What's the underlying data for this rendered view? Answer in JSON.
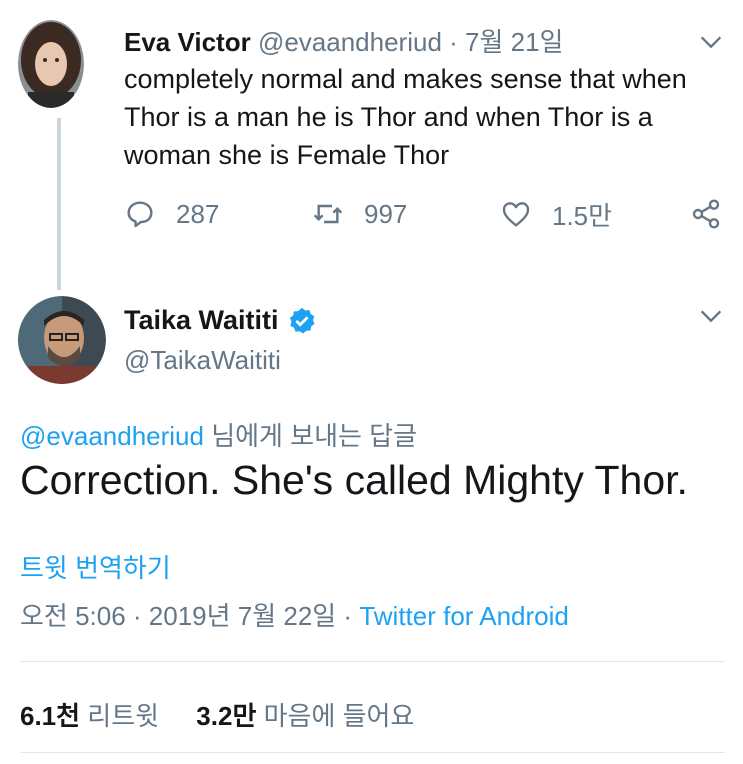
{
  "parent_tweet": {
    "author_name": "Eva Victor",
    "author_handle": "@evaandheriud",
    "separator": " · ",
    "date": "7월 21일",
    "text": "completely normal and makes sense that when Thor is a man he is Thor and when Thor is a woman she is Female Thor",
    "reply_count": "287",
    "retweet_count": "997",
    "like_count": "1.5만"
  },
  "main_tweet": {
    "author_name": "Taika Waititi",
    "author_handle": "@TaikaWaititi",
    "reply_to_handle": "@evaandheriud",
    "reply_to_suffix": " 님에게 보내는 답글",
    "text": "Correction. She's called Mighty Thor.",
    "translate_label": "트윗 번역하기",
    "timestamp": "오전 5:06 · 2019년 7월 22일 · ",
    "source": "Twitter for Android",
    "retweet_count": "6.1천",
    "retweet_label": " 리트윗",
    "like_count": "3.2만",
    "like_label": " 마음에 들어요"
  },
  "colors": {
    "accent": "#1da1f2",
    "muted": "#657786",
    "text": "#14171a",
    "divider": "#e1e8ed"
  },
  "icons": [
    "chevron-down-icon",
    "reply-icon",
    "retweet-icon",
    "like-icon",
    "share-icon",
    "verified-badge-icon"
  ]
}
